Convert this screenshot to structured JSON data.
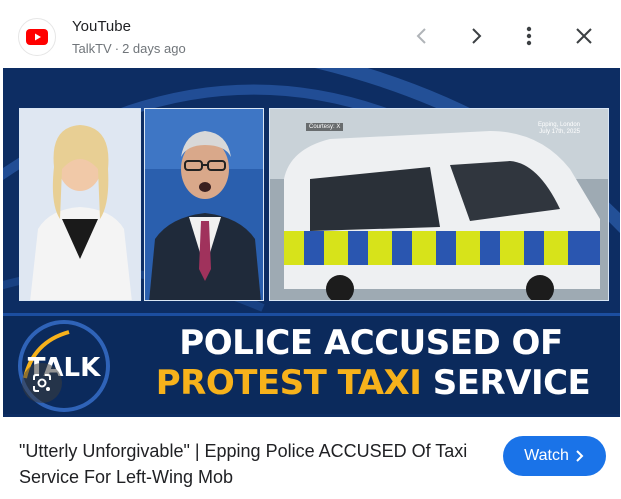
{
  "header": {
    "site_name": "YouTube",
    "channel": "TalkTV",
    "separator": "·",
    "time_ago": "2 days ago",
    "icons": {
      "logo": "youtube-logo-icon",
      "prev": "chevron-left-icon",
      "next": "chevron-right-icon",
      "more": "more-vert-icon",
      "close": "close-icon"
    }
  },
  "thumbnail": {
    "panel_c_tag": "Courtesy: X",
    "location_line1": "Epping, London",
    "location_line2": "July 17th, 2025",
    "logo_text": "TALK",
    "headline_line1": "POLICE ACCUSED OF",
    "headline_line2_yellow": "PROTEST TAXI",
    "headline_line2_white": "SERVICE",
    "lens_icon": "google-lens-icon"
  },
  "footer": {
    "title": "\"Utterly Unforgivable\" | Epping Police ACCUSED Of Taxi Service For Left-Wing Mob",
    "watch_label": "Watch",
    "watch_icon": "chevron-right-icon"
  },
  "colors": {
    "accent": "#1a73e8",
    "youtube_red": "#ff0000",
    "banner_navy": "#0b2a5c",
    "headline_yellow": "#f7b21b"
  }
}
